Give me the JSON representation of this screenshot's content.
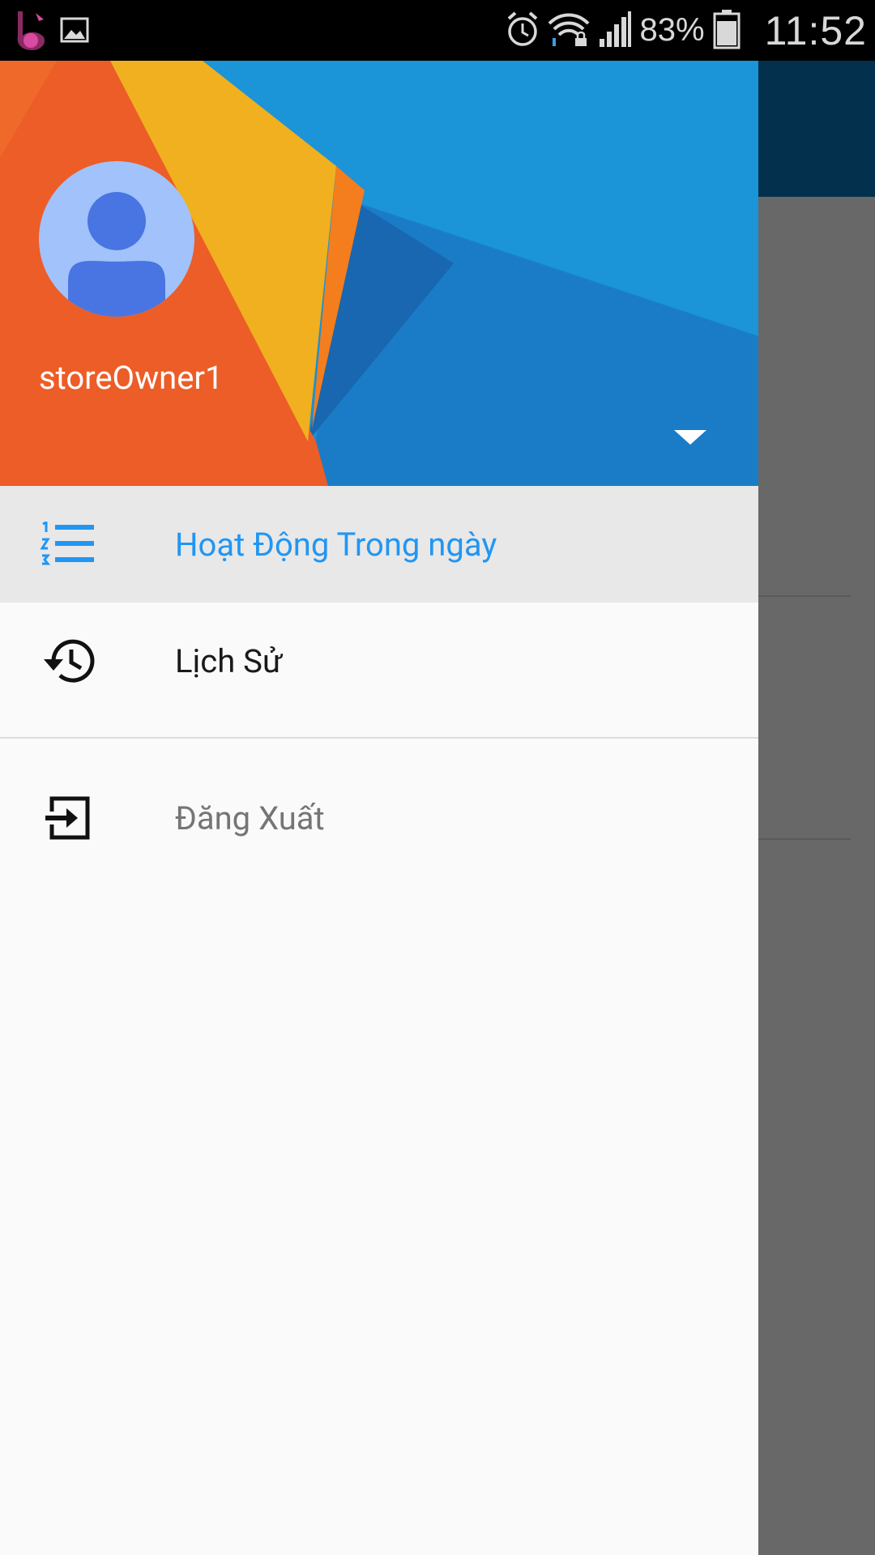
{
  "status_bar": {
    "battery_percent": "83%",
    "time": "11:52",
    "icons": [
      "music-app-icon",
      "gallery-icon",
      "alarm-icon",
      "wifi-icon",
      "signal-icon",
      "battery-icon"
    ]
  },
  "drawer": {
    "username": "storeOwner1",
    "menu": [
      {
        "label": "Hoạt Động Trong ngày",
        "icon": "numbered-list-icon",
        "active": true
      },
      {
        "label": "Lịch Sử",
        "icon": "history-icon",
        "active": false
      }
    ],
    "secondary": [
      {
        "label": "Đăng Xuất",
        "icon": "logout-icon"
      }
    ]
  },
  "colors": {
    "accent": "#2196f3",
    "active_bg": "#e8e8e8",
    "drawer_bg": "#fafafa",
    "scrim": "#686868",
    "toolbar_dark": "#02304d"
  }
}
